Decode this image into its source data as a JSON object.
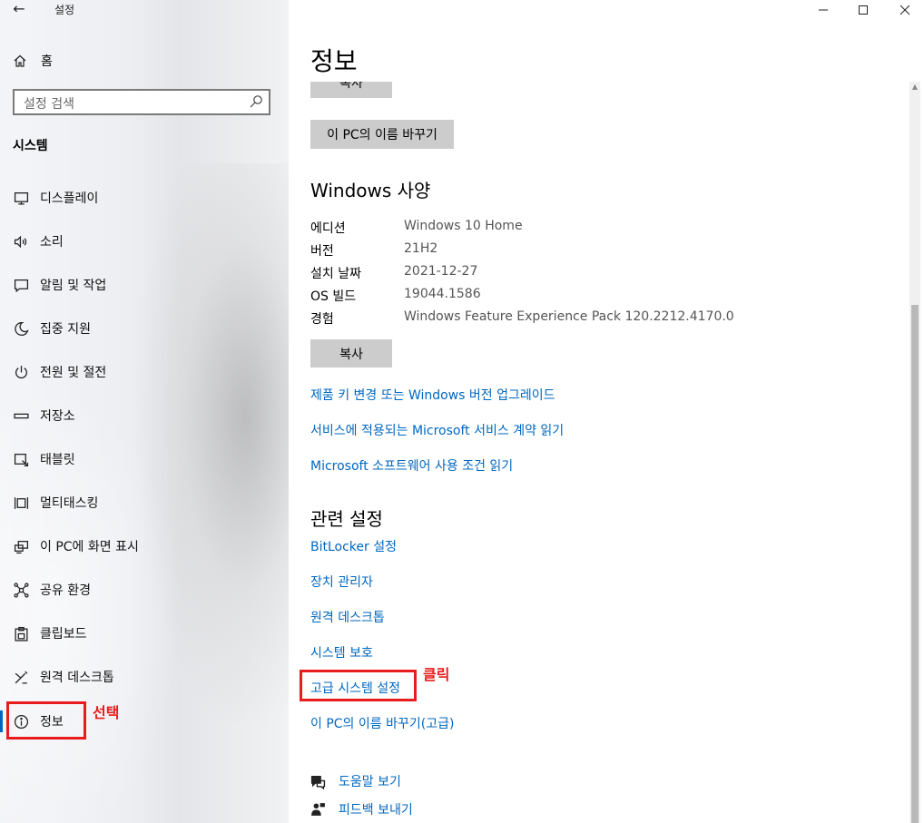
{
  "window": {
    "title": "설정",
    "back_label": "←"
  },
  "sidebar": {
    "home_label": "홈",
    "search_placeholder": "설정 검색",
    "section_title": "시스템",
    "items": [
      {
        "label": "디스플레이",
        "icon": "monitor-icon"
      },
      {
        "label": "소리",
        "icon": "speaker-icon"
      },
      {
        "label": "알림 및 작업",
        "icon": "notification-icon"
      },
      {
        "label": "집중 지원",
        "icon": "moon-icon"
      },
      {
        "label": "전원 및 절전",
        "icon": "power-icon"
      },
      {
        "label": "저장소",
        "icon": "storage-icon"
      },
      {
        "label": "태블릿",
        "icon": "tablet-icon"
      },
      {
        "label": "멀티태스킹",
        "icon": "multitasking-icon"
      },
      {
        "label": "이 PC에 화면 표시",
        "icon": "project-icon"
      },
      {
        "label": "공유 환경",
        "icon": "shared-experience-icon"
      },
      {
        "label": "클립보드",
        "icon": "clipboard-icon"
      },
      {
        "label": "원격 데스크톱",
        "icon": "remote-desktop-icon"
      },
      {
        "label": "정보",
        "icon": "info-icon",
        "selected": true
      }
    ]
  },
  "main": {
    "title": "정보",
    "copy_button_top": "복사",
    "rename_button": "이 PC의 이름 바꾸기",
    "windows_spec": {
      "heading": "Windows 사양",
      "rows": [
        {
          "label": "에디션",
          "value": "Windows 10 Home"
        },
        {
          "label": "버전",
          "value": "21H2"
        },
        {
          "label": "설치 날짜",
          "value": "2021-12-27"
        },
        {
          "label": "OS 빌드",
          "value": "19044.1586"
        },
        {
          "label": "경험",
          "value": "Windows Feature Experience Pack 120.2212.4170.0"
        }
      ],
      "copy_button": "복사"
    },
    "links": [
      "제품 키 변경 또는 Windows 버전 업그레이드",
      "서비스에 적용되는 Microsoft 서비스 계약 읽기",
      "Microsoft 소프트웨어 사용 조건 읽기"
    ],
    "related": {
      "heading": "관련 설정",
      "links": [
        "BitLocker 설정",
        "장치 관리자",
        "원격 데스크톱",
        "시스템 보호",
        "고급 시스템 설정",
        "이 PC의 이름 바꾸기(고급)"
      ]
    },
    "help": [
      {
        "label": "도움말 보기",
        "icon": "help-icon"
      },
      {
        "label": "피드백 보내기",
        "icon": "feedback-icon"
      }
    ]
  },
  "annotations": {
    "select_label": "선택",
    "click_label": "클릭",
    "color": "#e81c1c"
  },
  "colors": {
    "accent": "#0067c0",
    "button_bg": "#cccccc"
  }
}
